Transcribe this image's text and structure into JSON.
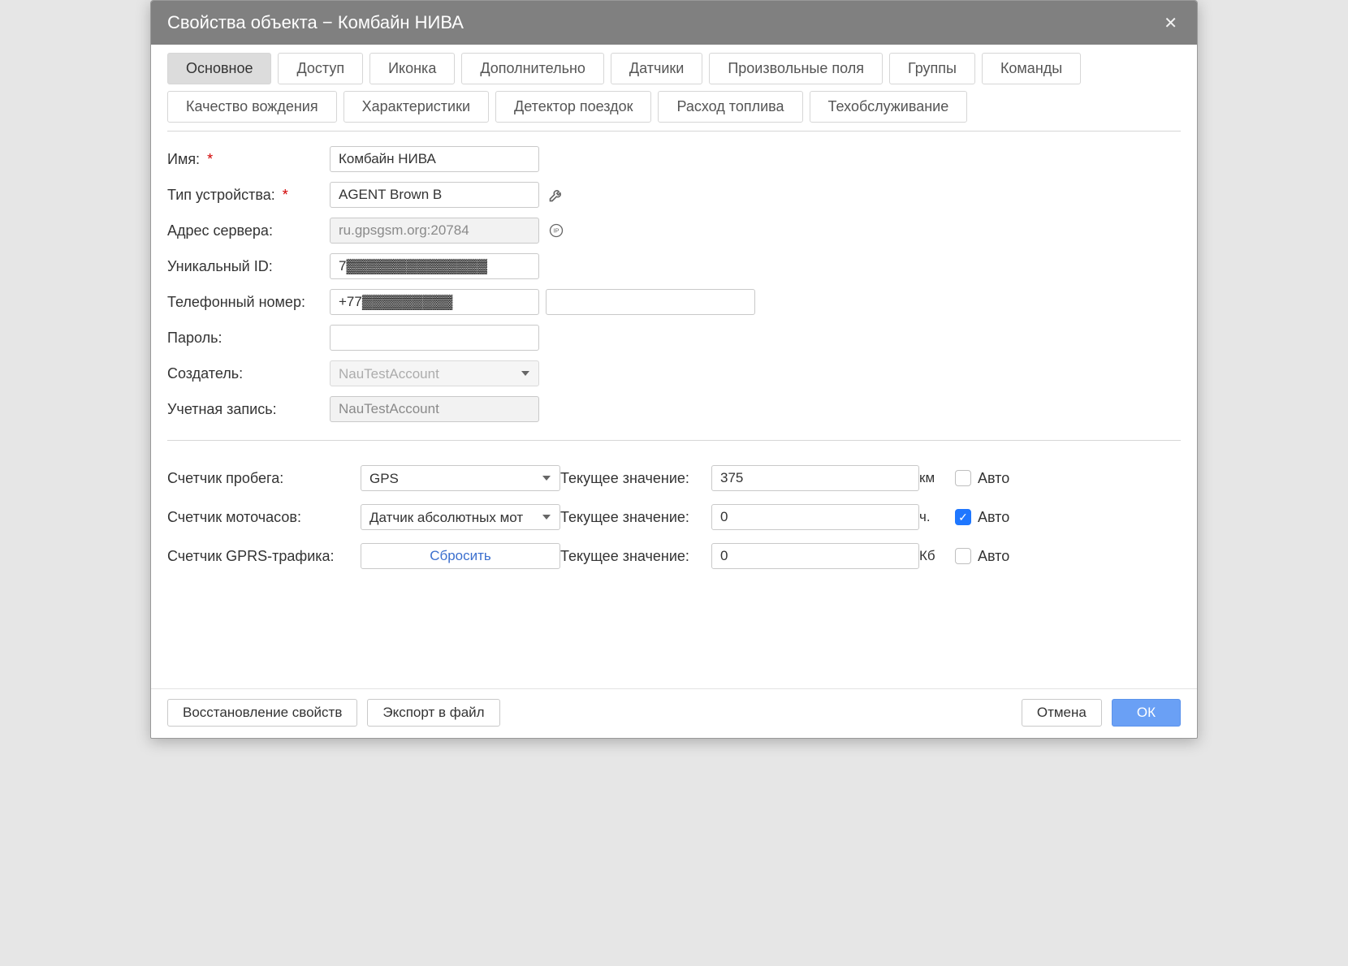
{
  "title": "Свойства объекта − Комбайн НИВА",
  "tabs": {
    "row1": [
      {
        "id": "general",
        "label": "Основное",
        "active": true
      },
      {
        "id": "access",
        "label": "Доступ"
      },
      {
        "id": "icon",
        "label": "Иконка"
      },
      {
        "id": "extra",
        "label": "Дополнительно"
      },
      {
        "id": "sensors",
        "label": "Датчики"
      },
      {
        "id": "custom",
        "label": "Произвольные поля"
      },
      {
        "id": "groups",
        "label": "Группы"
      },
      {
        "id": "cmds",
        "label": "Команды"
      }
    ],
    "row2": [
      {
        "id": "drive",
        "label": "Качество вождения"
      },
      {
        "id": "specs",
        "label": "Характеристики"
      },
      {
        "id": "trips",
        "label": "Детектор поездок"
      },
      {
        "id": "fuel",
        "label": "Расход топлива"
      },
      {
        "id": "maint",
        "label": "Техобслуживание"
      }
    ]
  },
  "form": {
    "name_label": "Имя:",
    "name_value": "Комбайн НИВА",
    "devtype_label": "Тип устройства:",
    "devtype_value": "AGENT Brown B",
    "server_label": "Адрес сервера:",
    "server_value": "ru.gpsgsm.org:20784",
    "uid_label": "Уникальный ID:",
    "uid_value": "7▓▓▓▓▓▓▓▓▓▓▓▓▓▓",
    "phone_label": "Телефонный номер:",
    "phone_value": "+77▓▓▓▓▓▓▓▓▓",
    "phone2_value": "",
    "pwd_label": "Пароль:",
    "pwd_value": "",
    "creator_label": "Создатель:",
    "creator_value": "NauTestAccount",
    "account_label": "Учетная запись:",
    "account_value": "NauTestAccount",
    "required_mark": "*"
  },
  "counters": {
    "cur_label": "Текущее значение:",
    "auto_label": "Авто",
    "mileage": {
      "label": "Счетчик пробега:",
      "mode": "GPS",
      "value": "375",
      "unit": "км",
      "auto": false
    },
    "engine": {
      "label": "Счетчик моточасов:",
      "mode": "Датчик абсолютных мот",
      "value": "0",
      "unit": "ч.",
      "auto": true
    },
    "gprs": {
      "label": "Счетчик GPRS-трафика:",
      "reset": "Сбросить",
      "value": "0",
      "unit": "Кб",
      "auto": false
    }
  },
  "footer": {
    "restore": "Восстановление свойств",
    "export": "Экспорт в файл",
    "cancel": "Отмена",
    "ok": "ОК"
  }
}
